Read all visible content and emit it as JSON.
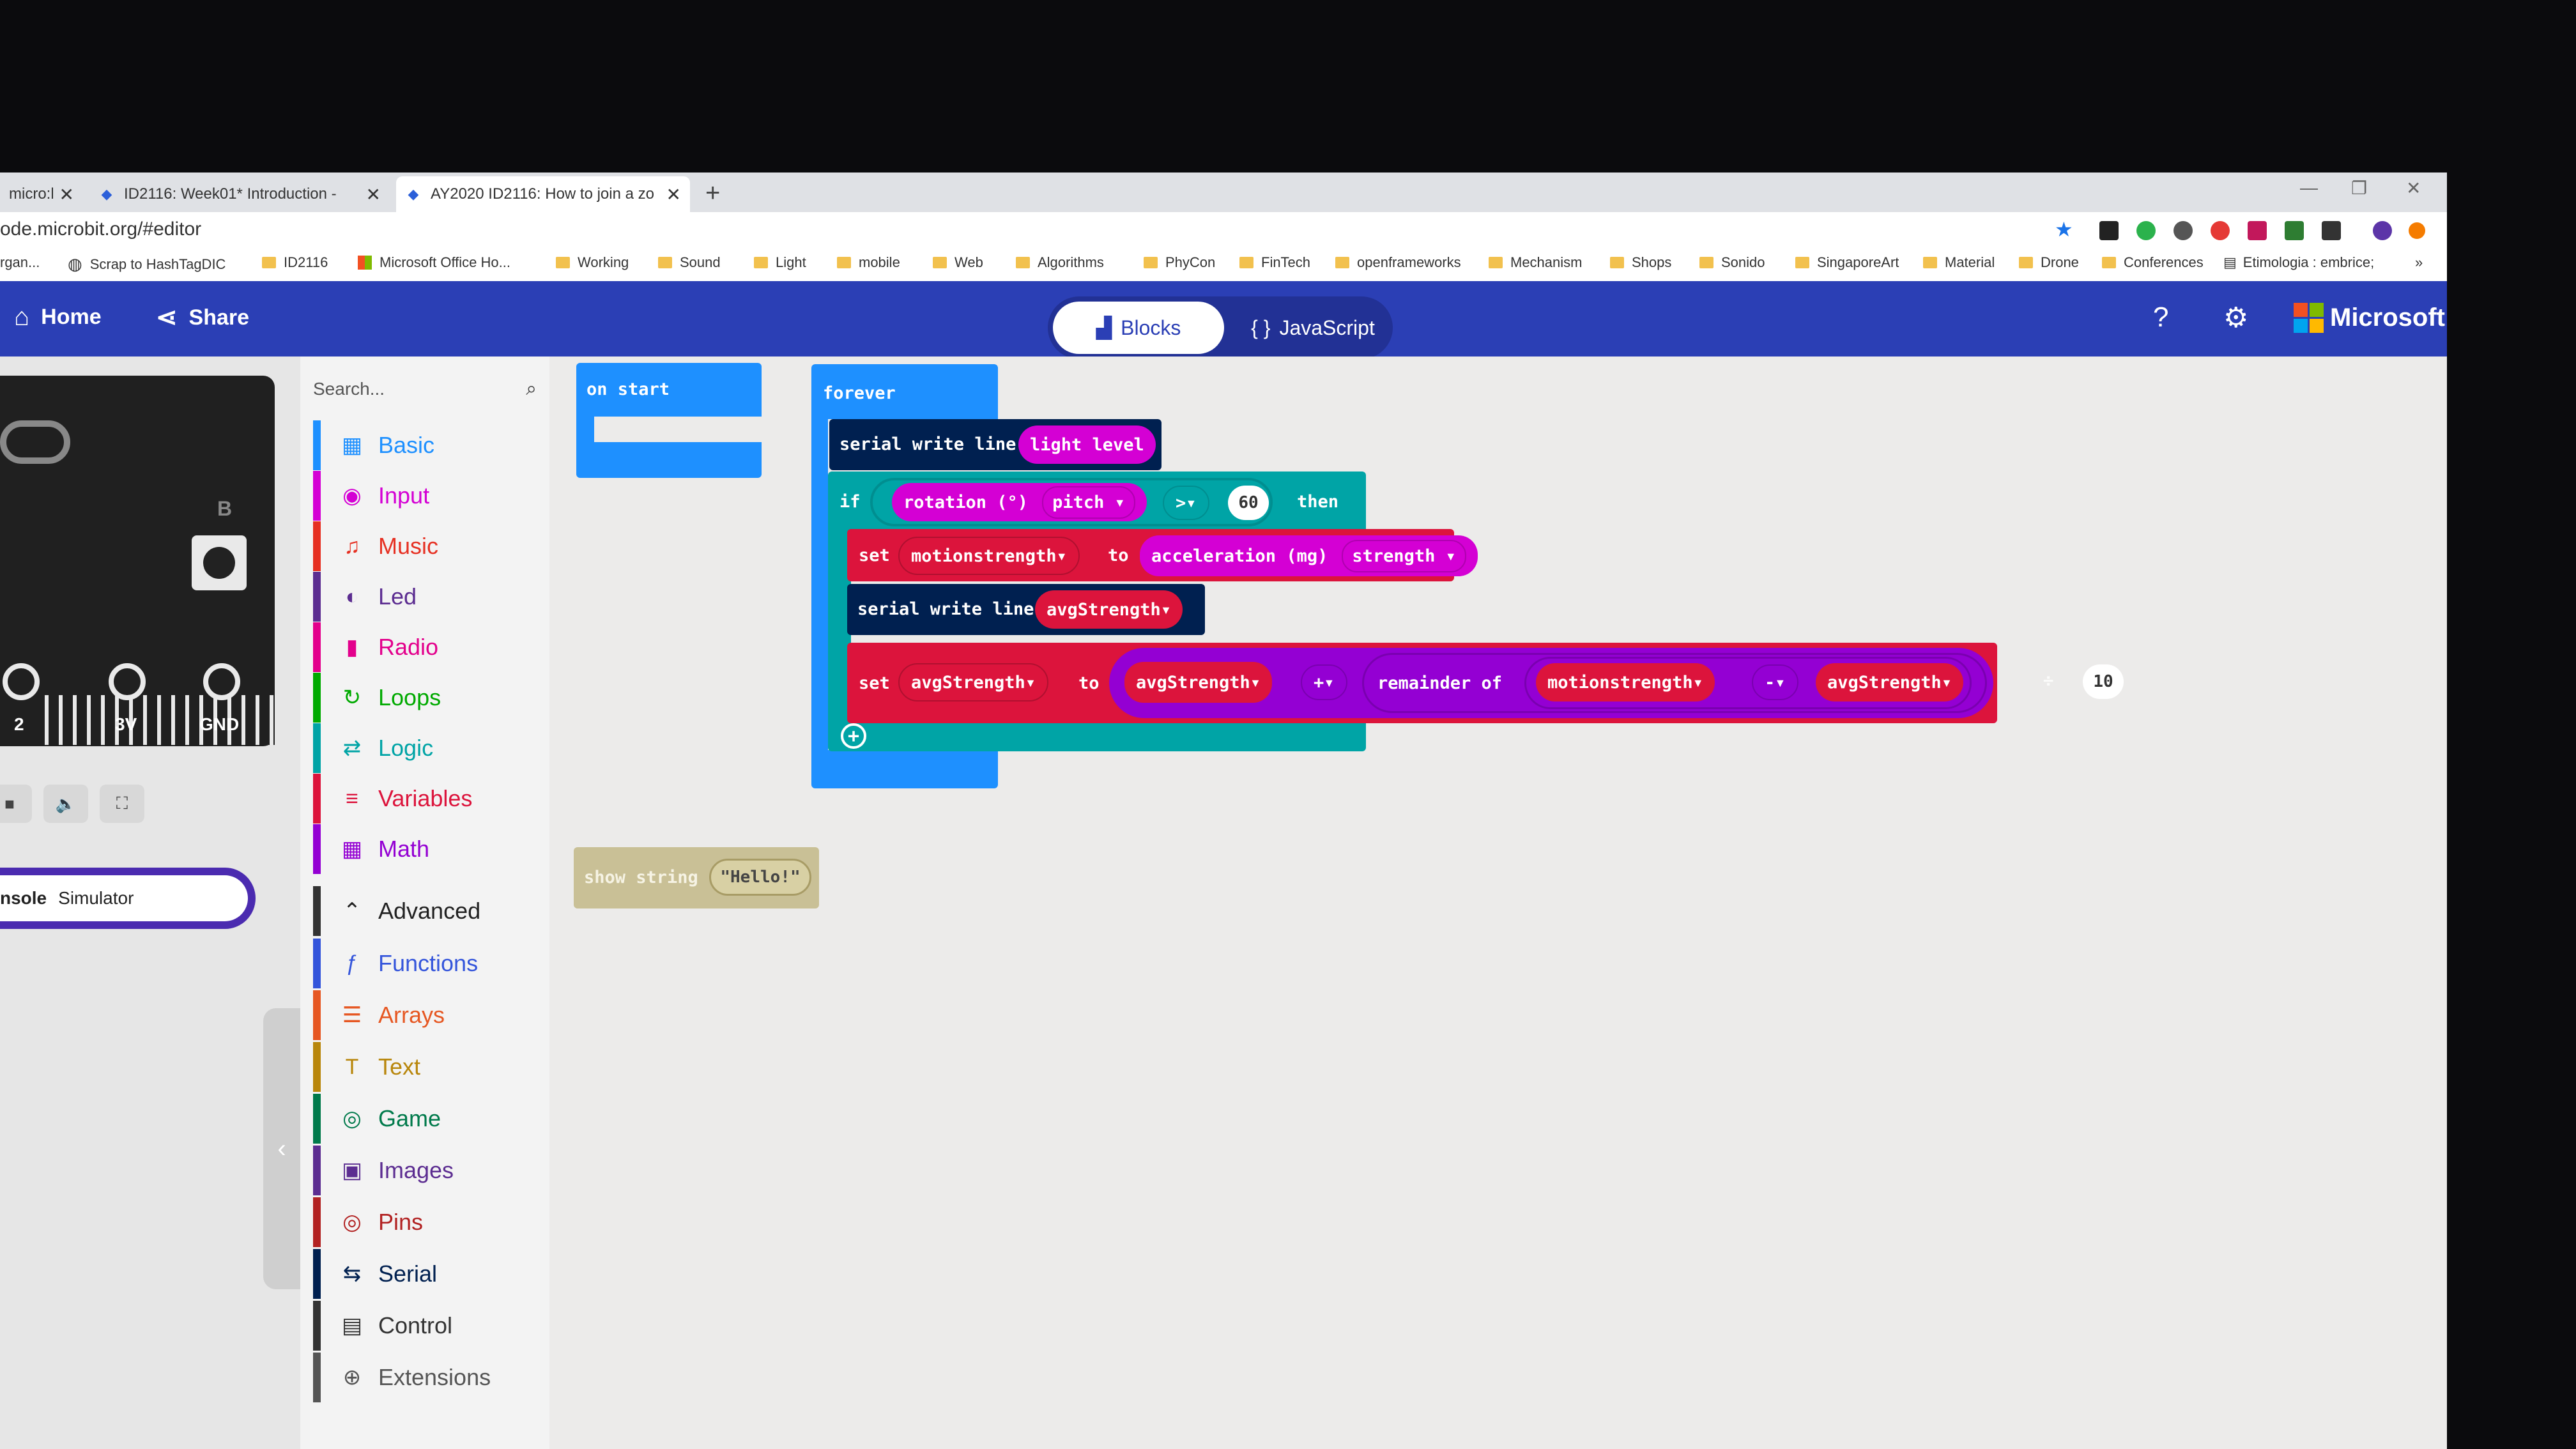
{
  "tabs": [
    {
      "title": "micro:b",
      "active": false
    },
    {
      "title": "ID2116: Week01* Introduction -",
      "active": false
    },
    {
      "title": "AY2020 ID2116: How to join a zo",
      "active": true
    }
  ],
  "new_tab_label": "+",
  "address_url": "ode.microbit.org/#editor",
  "bookmarks": [
    "rgan...",
    "Scrap to HashTagDIC",
    "ID2116",
    "Microsoft Office Ho...",
    "Working",
    "Sound",
    "Light",
    "mobile",
    "Web",
    "Algorithms",
    "PhyCon",
    "FinTech",
    "openframeworks",
    "Mechanism",
    "Shops",
    "Sonido",
    "SingaporeArt",
    "Material",
    "Drone",
    "Conferences",
    "Etimologia : embrice;"
  ],
  "bookmarks_more": "»",
  "header": {
    "home": "Home",
    "share": "Share",
    "blocks": "Blocks",
    "javascript": "JavaScript",
    "brand": "Microsoft"
  },
  "simulator": {
    "pins": [
      "2",
      "3V",
      "GND"
    ],
    "button_b": "B",
    "console_label": "nsole",
    "simulator_label": "Simulator"
  },
  "toolbox": {
    "search_placeholder": "Search...",
    "categories": [
      {
        "label": "Basic",
        "color": "#1e90ff"
      },
      {
        "label": "Input",
        "color": "#d400d4"
      },
      {
        "label": "Music",
        "color": "#e63022"
      },
      {
        "label": "Led",
        "color": "#5c2d91"
      },
      {
        "label": "Radio",
        "color": "#e3008c"
      },
      {
        "label": "Loops",
        "color": "#00aa00"
      },
      {
        "label": "Logic",
        "color": "#00a4a6"
      },
      {
        "label": "Variables",
        "color": "#dc143c"
      },
      {
        "label": "Math",
        "color": "#9400d3"
      }
    ],
    "advanced": "Advanced",
    "advanced_categories": [
      {
        "label": "Functions",
        "color": "#3455db"
      },
      {
        "label": "Arrays",
        "color": "#e65722"
      },
      {
        "label": "Text",
        "color": "#b8860b"
      },
      {
        "label": "Game",
        "color": "#007a4b"
      },
      {
        "label": "Images",
        "color": "#5c2d91"
      },
      {
        "label": "Pins",
        "color": "#b22222"
      },
      {
        "label": "Serial",
        "color": "#002050"
      },
      {
        "label": "Control",
        "color": "#333333"
      },
      {
        "label": "Extensions",
        "color": "#555555"
      }
    ]
  },
  "blocks": {
    "on_start": "on start",
    "forever": "forever",
    "serial_write_line": "serial write line",
    "light_level": "light level",
    "if_kw": "if",
    "rotation": "rotation (°)",
    "pitch": "pitch",
    "gt": ">",
    "sixty": "60",
    "then_kw": "then",
    "set_kw": "set",
    "motionstrength": "motionstrength",
    "to_kw": "to",
    "acceleration": "acceleration (mg)",
    "strength": "strength",
    "avgStrength": "avgStrength",
    "plus": "+",
    "remainder_of": "remainder of",
    "minus": "-",
    "divide": "÷",
    "ten": "10",
    "show_string": "show string",
    "hello": "Hello!"
  },
  "colors": {
    "header": "#2b3fb5",
    "serial": "#002050",
    "logic": "#00a4a6",
    "loops": "#00aa00",
    "variables": "#dc143c",
    "math": "#9400d3",
    "input": "#d400d4",
    "basic": "#1e90ff"
  }
}
